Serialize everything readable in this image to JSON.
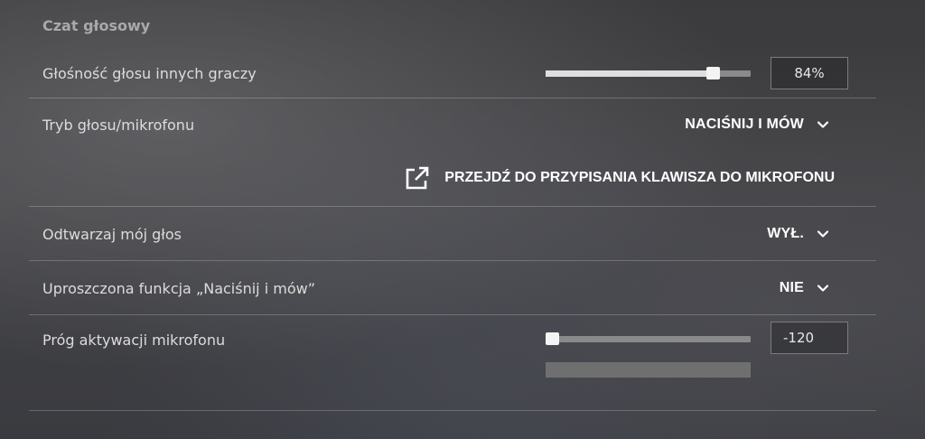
{
  "section": {
    "title": "Czat głosowy"
  },
  "rows": {
    "other_volume": {
      "label": "Głośność głosu innych graczy",
      "value": "84%",
      "level": 0.84
    },
    "voice_mode": {
      "label": "Tryb głosu/mikrofonu",
      "value": "NACIŚNIJ I MÓW"
    },
    "keybind_link": {
      "label": "PRZEJDŹ DO PRZYPISANIA KLAWISZA DO MIKROFONU"
    },
    "play_own_voice": {
      "label": "Odtwarzaj mój głos",
      "value": "WYŁ."
    },
    "simplified_ptt": {
      "label": "Uproszczona funkcja „Naciśnij i mów”",
      "value": "NIE"
    },
    "mic_threshold": {
      "label": "Próg aktywacji mikrofonu",
      "value": "-120",
      "level": 0.0
    }
  },
  "icons": {
    "chevron": "chevron-down-icon",
    "external": "external-link-icon"
  },
  "colors": {
    "text": "#dcdcdc",
    "section_title": "#a9a9a9",
    "track": "#8a8a8a",
    "fill": "#dedede"
  }
}
